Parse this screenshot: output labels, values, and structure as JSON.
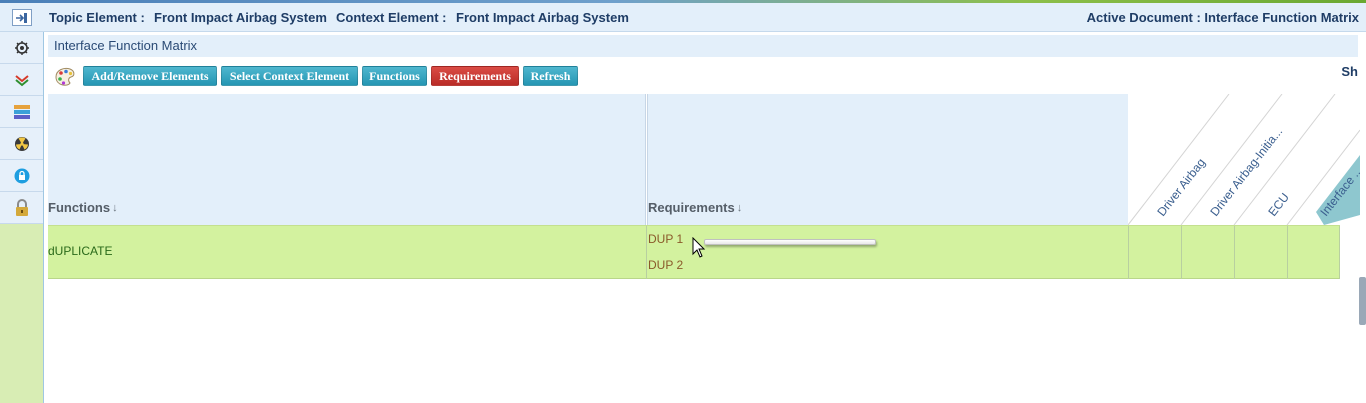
{
  "header": {
    "topic_label": "Topic Element :",
    "topic_value": "Front Impact Airbag System",
    "context_label": "Context Element :",
    "context_value": "Front Impact Airbag System",
    "active_document": "Active Document : Interface Function Matrix"
  },
  "sidebar": {
    "icons": [
      "expand-icon",
      "gear-icon",
      "layers-icon",
      "stack-icon",
      "radiation-icon",
      "lock-circle-icon",
      "padlock-icon"
    ]
  },
  "panel": {
    "title": "Interface Function Matrix"
  },
  "toolbar": {
    "add_remove": "Add/Remove Elements",
    "select_context": "Select Context Element",
    "functions": "Functions",
    "requirements": "Requirements",
    "refresh": "Refresh",
    "cut_text": "Sh"
  },
  "matrix": {
    "functions_header": "Functions",
    "requirements_header": "Requirements",
    "sort_glyph": "↓",
    "columns": [
      "Driver Airbag",
      "Driver Airbag-Initia...",
      "ECU",
      "Interface ..."
    ],
    "rows": [
      {
        "function": "dUPLICATE",
        "requirements": [
          "DUP 1",
          "DUP 2"
        ]
      }
    ]
  },
  "colors": {
    "accent_teal": "#2596b3",
    "accent_red": "#b92c27",
    "row_green": "#d3f29f",
    "header_blue": "#e3effa"
  }
}
